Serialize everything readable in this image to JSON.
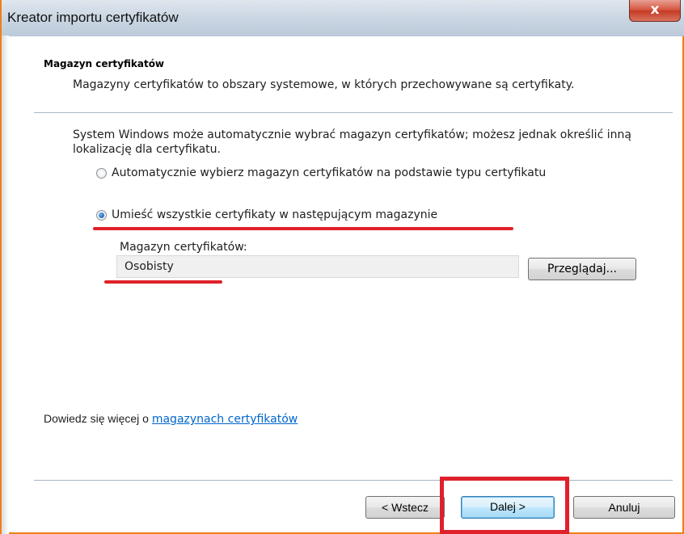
{
  "window": {
    "title": "Kreator importu certyfikatów",
    "close_glyph": "x"
  },
  "header": {
    "title": "Magazyn certyfikatów",
    "description": "Magazyny certyfikatów to obszary systemowe, w których przechowywane są certyfikaty."
  },
  "body": {
    "intro": "System Windows może automatycznie wybrać magazyn certyfikatów; możesz jednak określić inną lokalizację dla certyfikatu.",
    "options": [
      {
        "label": "Automatycznie wybierz magazyn certyfikatów na podstawie typu certyfikatu",
        "selected": false
      },
      {
        "label": "Umieść wszystkie certyfikaty w następującym magazynie",
        "selected": true
      }
    ],
    "store_label": "Magazyn certyfikatów:",
    "store_value": "Osobisty",
    "browse_label": "Przeglądaj..."
  },
  "learn_more": {
    "prefix": "Dowiedz się więcej o ",
    "link": "magazynach certyfikatów"
  },
  "footer": {
    "back_label": "< Wstecz",
    "next_label": "Dalej >",
    "cancel_label": "Anuluj"
  },
  "colors": {
    "annotation": "#e0202a",
    "window_border": "#f07f19",
    "link": "#0066cc"
  },
  "icons": [
    "close-icon",
    "radio-icon"
  ]
}
